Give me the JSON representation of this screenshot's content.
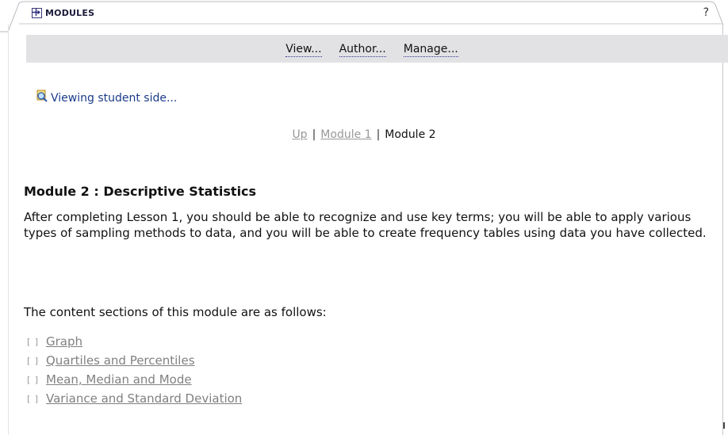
{
  "header": {
    "title": "MODULES",
    "help_label": "?"
  },
  "toolbar": {
    "items": [
      {
        "label": "View..."
      },
      {
        "label": "Author..."
      },
      {
        "label": "Manage..."
      }
    ]
  },
  "status": {
    "text": "Viewing student side..."
  },
  "breadcrumb": {
    "up": "Up",
    "sep1": "|",
    "module1": "Module 1",
    "sep2": "|",
    "current": "Module 2"
  },
  "module": {
    "title": "Module 2 : Descriptive Statistics",
    "description": "After completing Lesson 1, you should be able to recognize and use key terms; you will be able to apply various types of sampling methods to data, and you will be able to create frequency tables using data you have collected.",
    "sections_intro": "The content sections of this module are as follows:",
    "sections": [
      {
        "bullet": "[ ]",
        "label": "Graph"
      },
      {
        "bullet": "[ ]",
        "label": "Quartiles and Percentiles"
      },
      {
        "bullet": "[ ]",
        "label": "Mean, Median and Mode"
      },
      {
        "bullet": "[ ]",
        "label": "Variance and Standard Deviation"
      }
    ]
  },
  "colors": {
    "toolbar_bg": "#e2e2e4",
    "link_muted": "#808080",
    "status_text": "#1a3a8a"
  }
}
